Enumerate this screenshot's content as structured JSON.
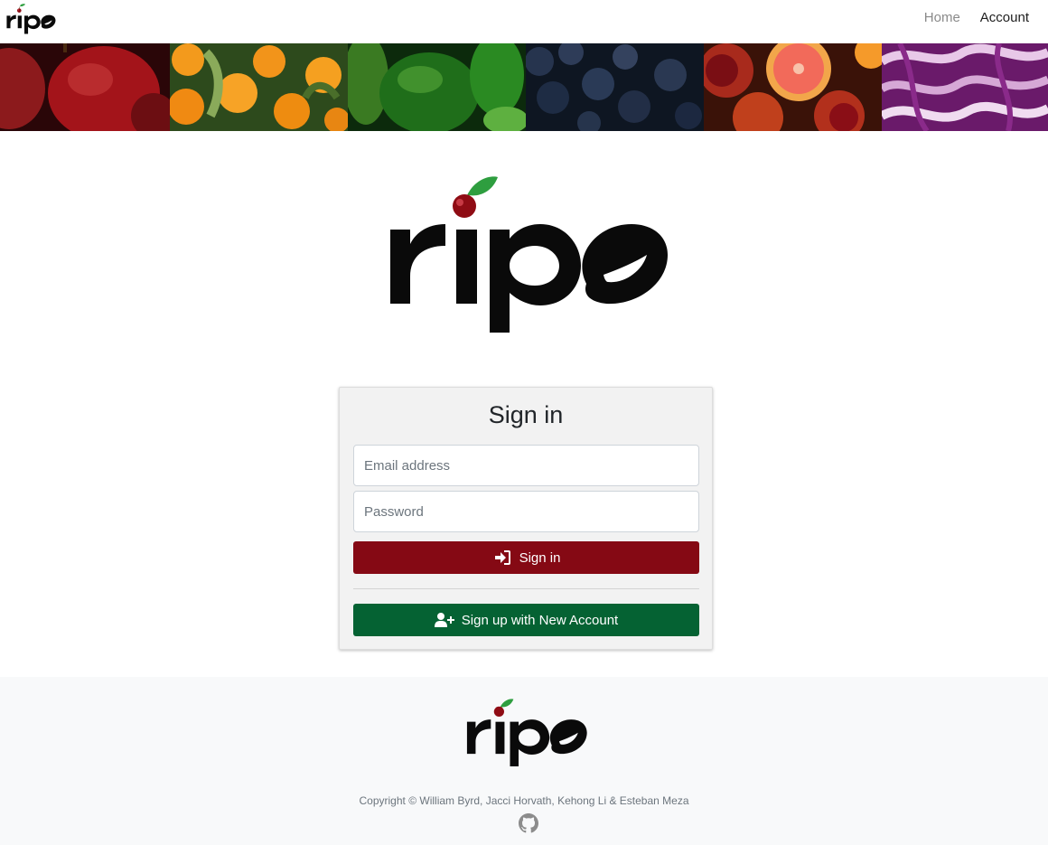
{
  "navbar": {
    "logo_text": "ripe",
    "links": [
      {
        "label": "Home"
      },
      {
        "label": "Account"
      }
    ]
  },
  "banner": {
    "tiles": [
      "apples",
      "oranges",
      "green-peppers",
      "blueberries",
      "grapefruit-pomegranate",
      "red-cabbage"
    ]
  },
  "logo": {
    "text": "ripe"
  },
  "signin_card": {
    "title": "Sign in",
    "email_placeholder": "Email address",
    "password_placeholder": "Password",
    "signin_label": "Sign in",
    "signup_label": "Sign up with New Account"
  },
  "footer": {
    "logo_text": "ripe",
    "copyright": "Copyright © William Byrd, Jacci Horvath, Kehong Li & Esteban Meza"
  },
  "colors": {
    "signin_button": "#850914",
    "signup_button": "#056233",
    "cherry": "#8f0c14",
    "leaf": "#2e9e3f",
    "footer_bg": "#f8f9fa"
  },
  "icons": {
    "signin": "sign-in-icon",
    "signup": "user-plus-icon",
    "github": "github-icon"
  }
}
